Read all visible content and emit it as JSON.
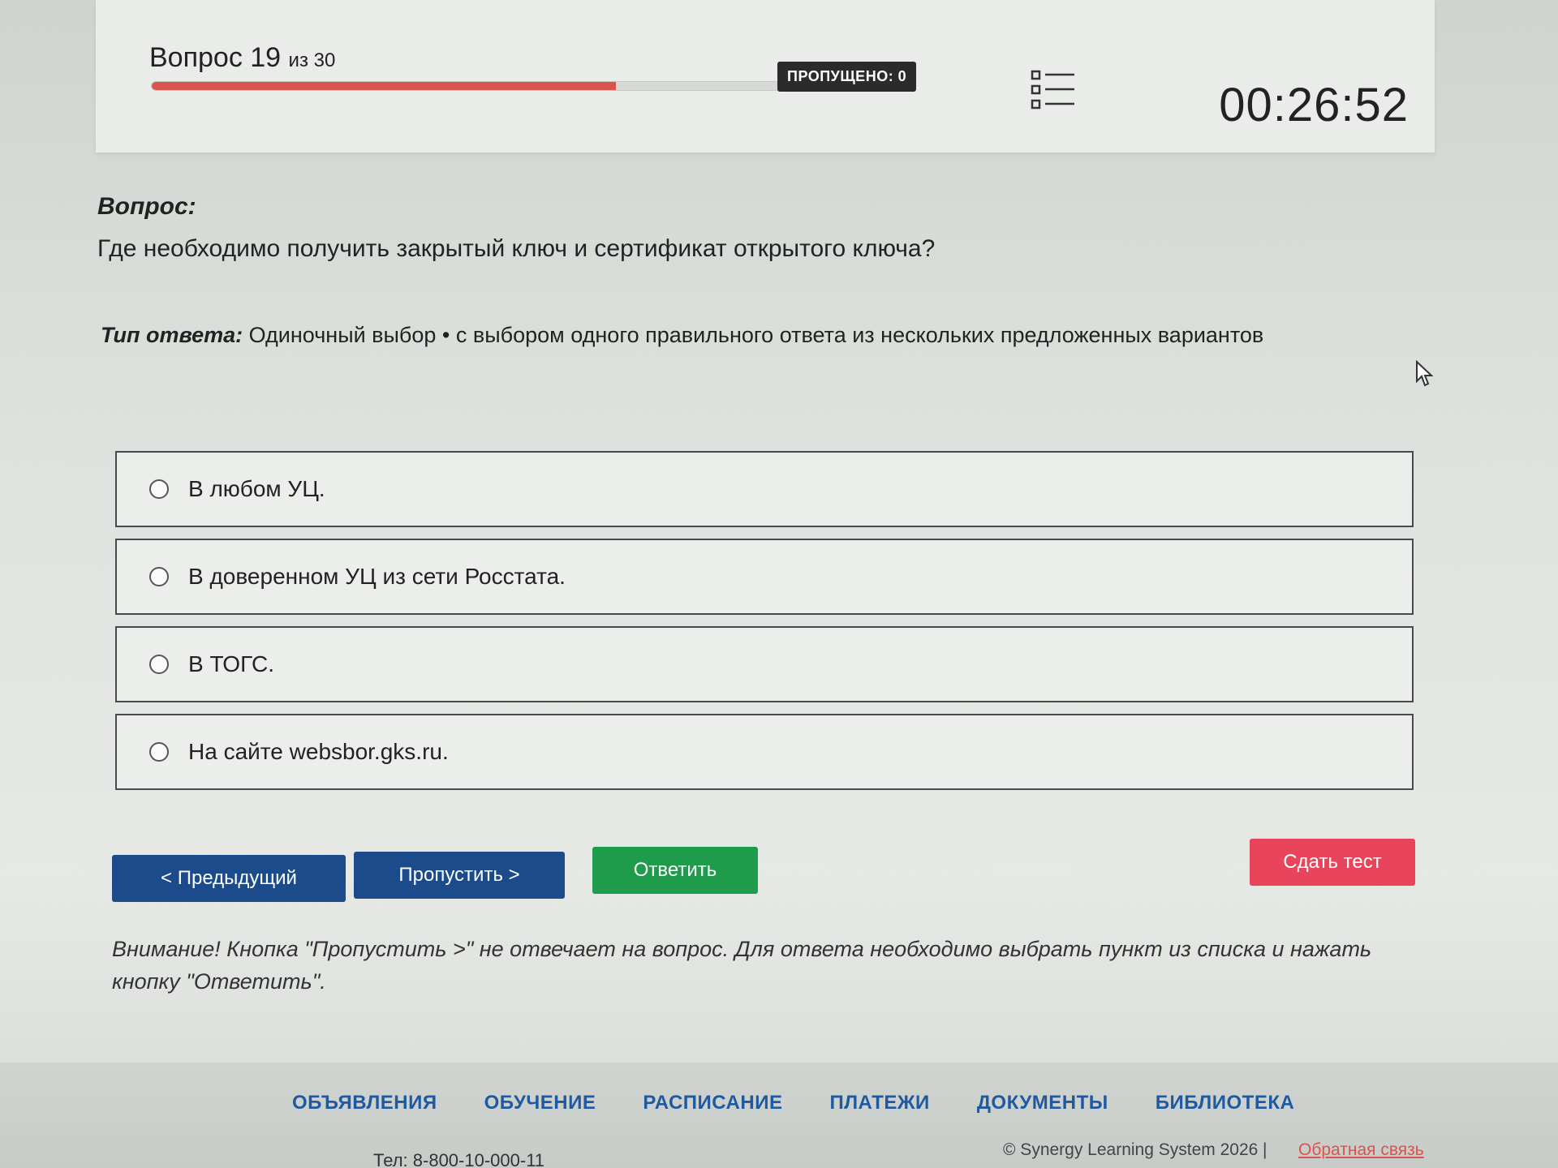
{
  "header": {
    "question_label": "Вопрос 19",
    "question_of": "из 30",
    "progress": 0.61,
    "skipped": "ПРОПУЩЕНО: 0",
    "list_icon": "list-icon",
    "timer": "00:26:52"
  },
  "question": {
    "label": "Вопрос:",
    "text": "Где необходимо получить закрытый ключ и сертификат открытого ключа?"
  },
  "answer_type": {
    "label": "Тип ответа:",
    "value": "Одиночный выбор • с выбором одного правильного ответа из нескольких предложенных вариантов"
  },
  "options": [
    {
      "label": "В любом УЦ."
    },
    {
      "label": "В доверенном УЦ из сети Росстата."
    },
    {
      "label": "В ТОГС."
    },
    {
      "label": "На сайте websbor.gks.ru."
    }
  ],
  "buttons": {
    "prev": "< Предыдущий",
    "skip": "Пропустить >",
    "answer": "Ответить",
    "submit": "Сдать тест"
  },
  "warning": "Внимание! Кнопка \"Пропустить >\" не отвечает на вопрос. Для ответа необходимо выбрать пункт из списка и нажать кнопку \"Ответить\".",
  "footer": {
    "nav": [
      "ОБЪЯВЛЕНИЯ",
      "ОБУЧЕНИЕ",
      "РАСПИСАНИЕ",
      "ПЛАТЕЖИ",
      "ДОКУМЕНТЫ",
      "БИБЛИОТЕКА"
    ],
    "phone": "Тел: 8-800-10-000-11",
    "copyright": "© Synergy Learning System 2026",
    "separator": "|",
    "feedback": "Обратная связь"
  },
  "colors": {
    "progress": "#d9534f",
    "primary_button": "#1c4b8c",
    "answer_button": "#1e9b4b",
    "submit_button": "#e8455c",
    "footer_link": "#1f5aa0"
  }
}
